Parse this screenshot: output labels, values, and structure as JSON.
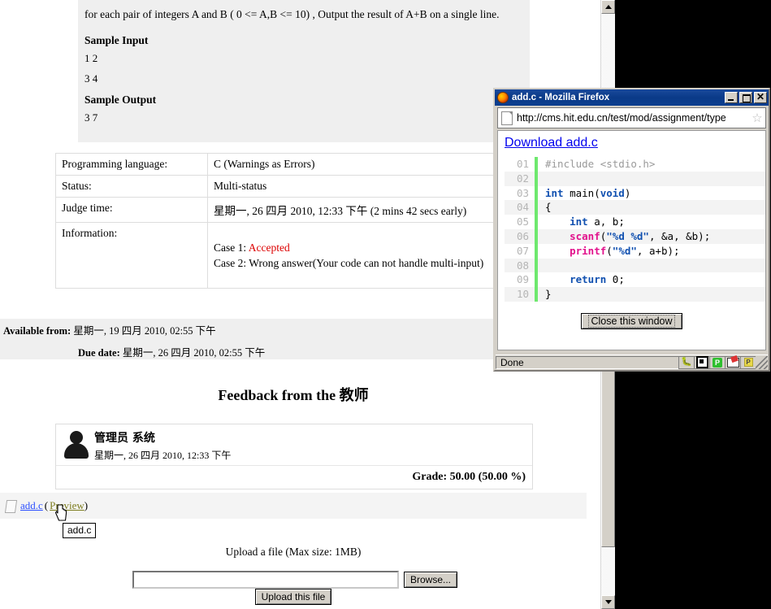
{
  "page": {
    "description": {
      "body": "for each pair of integers A and B ( 0 <= A,B <= 10) , Output the result of A+B on a single line.",
      "sample_input_heading": "Sample Input",
      "sample_input_lines": [
        "1 2",
        "3 4"
      ],
      "sample_output_heading": "Sample Output",
      "sample_output_lines": [
        "3 7"
      ]
    },
    "info_table": {
      "rows": [
        {
          "label": "Programming language:",
          "value": "C (Warnings as Errors)"
        },
        {
          "label": "Status:",
          "value": "Multi-status"
        },
        {
          "label": "Judge time:",
          "value": "星期一, 26 四月 2010, 12:33 下午 (2 mins 42 secs early)"
        }
      ],
      "information_label": "Information:",
      "case1_prefix": "Case 1: ",
      "case1_status": "Accepted",
      "case2": "Case 2: Wrong answer(Your code can not handle multi-input)"
    },
    "dates": {
      "available_from_label": "Available from:",
      "available_from_value": " 星期一, 19 四月 2010, 02:55 下午",
      "due_date_label": "Due date:",
      "due_date_value": " 星期一, 26 四月 2010, 02:55 下午"
    },
    "feedback": {
      "title": "Feedback from the 教师",
      "author": "管理员 系统",
      "date": "星期一, 26 四月 2010, 12:33 下午",
      "grade": "Grade: 50.00 (50.00 %)"
    },
    "attachment": {
      "filename": "add.c",
      "open_paren": "(",
      "preview_label": "Preview",
      "close_paren": ")",
      "tooltip": "add.c"
    },
    "upload": {
      "label": "Upload a file (Max size: 1MB)",
      "input_value": "",
      "input_placeholder": "",
      "browse_label": "Browse...",
      "submit_label": "Upload this file"
    }
  },
  "firefox": {
    "title": "add.c - Mozilla Firefox",
    "min_label": "",
    "max_label": "",
    "close_label": "✕",
    "url": "http://cms.hit.edu.cn/test/mod/assignment/type",
    "download_link": "Download add.c",
    "close_window_label": "Close this window",
    "status": "Done",
    "code_lines": [
      {
        "num": "01",
        "tokens": [
          {
            "t": "#include <stdio.h>",
            "c": "c-pre"
          }
        ]
      },
      {
        "num": "02",
        "tokens": [
          {
            "t": "",
            "c": ""
          }
        ]
      },
      {
        "num": "03",
        "tokens": [
          {
            "t": "int",
            "c": "c-kw"
          },
          {
            "t": " main(",
            "c": ""
          },
          {
            "t": "void",
            "c": "c-kw"
          },
          {
            "t": ")",
            "c": ""
          }
        ]
      },
      {
        "num": "04",
        "tokens": [
          {
            "t": "{",
            "c": ""
          }
        ]
      },
      {
        "num": "05",
        "tokens": [
          {
            "t": "    ",
            "c": ""
          },
          {
            "t": "int",
            "c": "c-kw"
          },
          {
            "t": " a, b;",
            "c": ""
          }
        ]
      },
      {
        "num": "06",
        "tokens": [
          {
            "t": "    ",
            "c": ""
          },
          {
            "t": "scanf",
            "c": "c-fn"
          },
          {
            "t": "(",
            "c": ""
          },
          {
            "t": "\"%d %d\"",
            "c": "c-str"
          },
          {
            "t": ", &a, &b);",
            "c": ""
          }
        ]
      },
      {
        "num": "07",
        "tokens": [
          {
            "t": "    ",
            "c": ""
          },
          {
            "t": "printf",
            "c": "c-fn"
          },
          {
            "t": "(",
            "c": ""
          },
          {
            "t": "\"%d\"",
            "c": "c-str"
          },
          {
            "t": ", a+b);",
            "c": ""
          }
        ]
      },
      {
        "num": "08",
        "tokens": [
          {
            "t": "",
            "c": ""
          }
        ]
      },
      {
        "num": "09",
        "tokens": [
          {
            "t": "    ",
            "c": ""
          },
          {
            "t": "return",
            "c": "c-kw"
          },
          {
            "t": " 0;",
            "c": ""
          }
        ]
      },
      {
        "num": "10",
        "tokens": [
          {
            "t": "}",
            "c": ""
          }
        ]
      }
    ],
    "status_icons": [
      "bug-icon",
      "stop-icon",
      "green-p-icon",
      "mail-icon",
      "yellow-p-icon",
      "resize-grip-icon"
    ]
  },
  "colors": {
    "title_bar": "#0a3a88",
    "accepted": "#dd0000",
    "link": "#2b4eff",
    "preview_link": "#7d7d1f",
    "gutter": "#6ee86e",
    "keyword": "#1050b0",
    "function": "#e2128c"
  }
}
